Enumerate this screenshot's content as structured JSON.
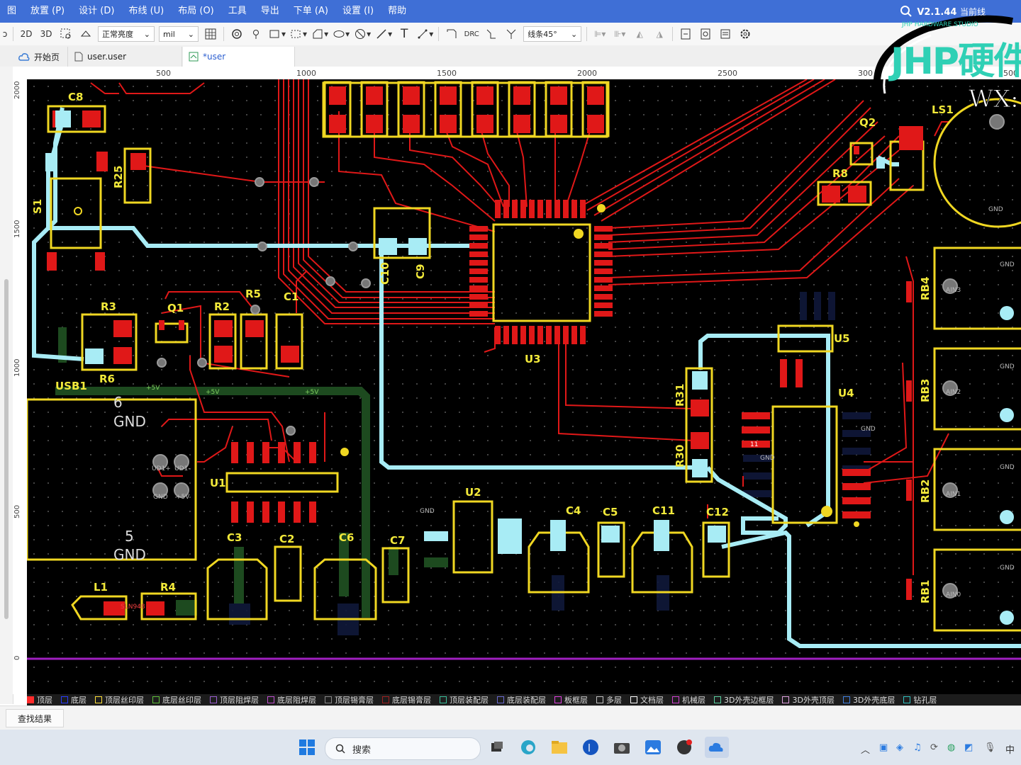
{
  "menu": {
    "items": [
      "图",
      "放置 (P)",
      "设计 (D)",
      "布线 (U)",
      "布局 (O)",
      "工具",
      "导出",
      "下单 (A)",
      "设置 (I)",
      "帮助"
    ],
    "version": "V2.1.44",
    "version_suffix": "当前线"
  },
  "toolbar": {
    "view_2d": "2D",
    "view_3d": "3D",
    "brightness_select": "正常亮度",
    "unit_select": "mil",
    "route_angle_select": "线条45°",
    "drc_label": "DRC"
  },
  "tabs": [
    {
      "label": "开始页"
    },
    {
      "label": "user.user"
    },
    {
      "label": "*user"
    }
  ],
  "ruler": {
    "h_ticks": [
      "500",
      "1000",
      "1500",
      "2000",
      "2500",
      "300",
      "3500"
    ],
    "v_ticks": [
      "2000",
      "1500",
      "1000",
      "500",
      "0"
    ]
  },
  "canvas": {
    "designators": [
      "C8",
      "R25",
      "S1",
      "R3",
      "Q1",
      "R2",
      "R5",
      "C1",
      "R6",
      "USB1",
      "C10",
      "C9",
      "U3",
      "Q2",
      "R8",
      "LS1",
      "U5",
      "U4",
      "R31",
      "R30",
      "RB4",
      "RB3",
      "RB2",
      "RB1",
      "U1",
      "C3",
      "C2",
      "C6",
      "C7",
      "U2",
      "C4",
      "C5",
      "C11",
      "C12",
      "L1",
      "R4"
    ],
    "net_labels": {
      "gnd": "GND",
      "p5v": "+5V",
      "usb_gnd_num": "6",
      "usb_gnd_num2": "5",
      "ud_plus": "UD1+",
      "ud_minus": "UD1-",
      "ain3": "AIN3",
      "ain2": "AIN2",
      "ain1": "AIN1",
      "ain0": "AIN0",
      "n11": "11",
      "sln": "SLN948"
    }
  },
  "logo": {
    "text": "JHP硬件",
    "subtitle": "JHP HARDWARE STUDIO",
    "wx": "WX:"
  },
  "layers": [
    {
      "label": "顶层",
      "color": "#ff2a2a"
    },
    {
      "label": "底层",
      "color": "#2a3cff"
    },
    {
      "label": "顶层丝印层",
      "color": "#ffe03a"
    },
    {
      "label": "底层丝印层",
      "color": "#5fbf3a"
    },
    {
      "label": "顶层阻焊层",
      "color": "#9a5fd0"
    },
    {
      "label": "底层阻焊层",
      "color": "#c050d0"
    },
    {
      "label": "顶层锡膏层",
      "color": "#888888"
    },
    {
      "label": "底层锡膏层",
      "color": "#a02020"
    },
    {
      "label": "顶层装配层",
      "color": "#3ac09a"
    },
    {
      "label": "底层装配层",
      "color": "#6a6ad0"
    },
    {
      "label": "板框层",
      "color": "#e040e0"
    },
    {
      "label": "多层",
      "color": "#c0c0c0"
    },
    {
      "label": "文档层",
      "color": "#ffffff"
    },
    {
      "label": "机械层",
      "color": "#d040d0"
    },
    {
      "label": "3D外壳边框层",
      "color": "#5ad0a0"
    },
    {
      "label": "3D外壳顶层",
      "color": "#e0a0e0"
    },
    {
      "label": "3D外壳底层",
      "color": "#4080e0"
    },
    {
      "label": "钻孔层",
      "color": "#30c0c0"
    }
  ],
  "find_results": "查找结果",
  "taskbar": {
    "search_placeholder": "搜索",
    "ime": "中"
  }
}
